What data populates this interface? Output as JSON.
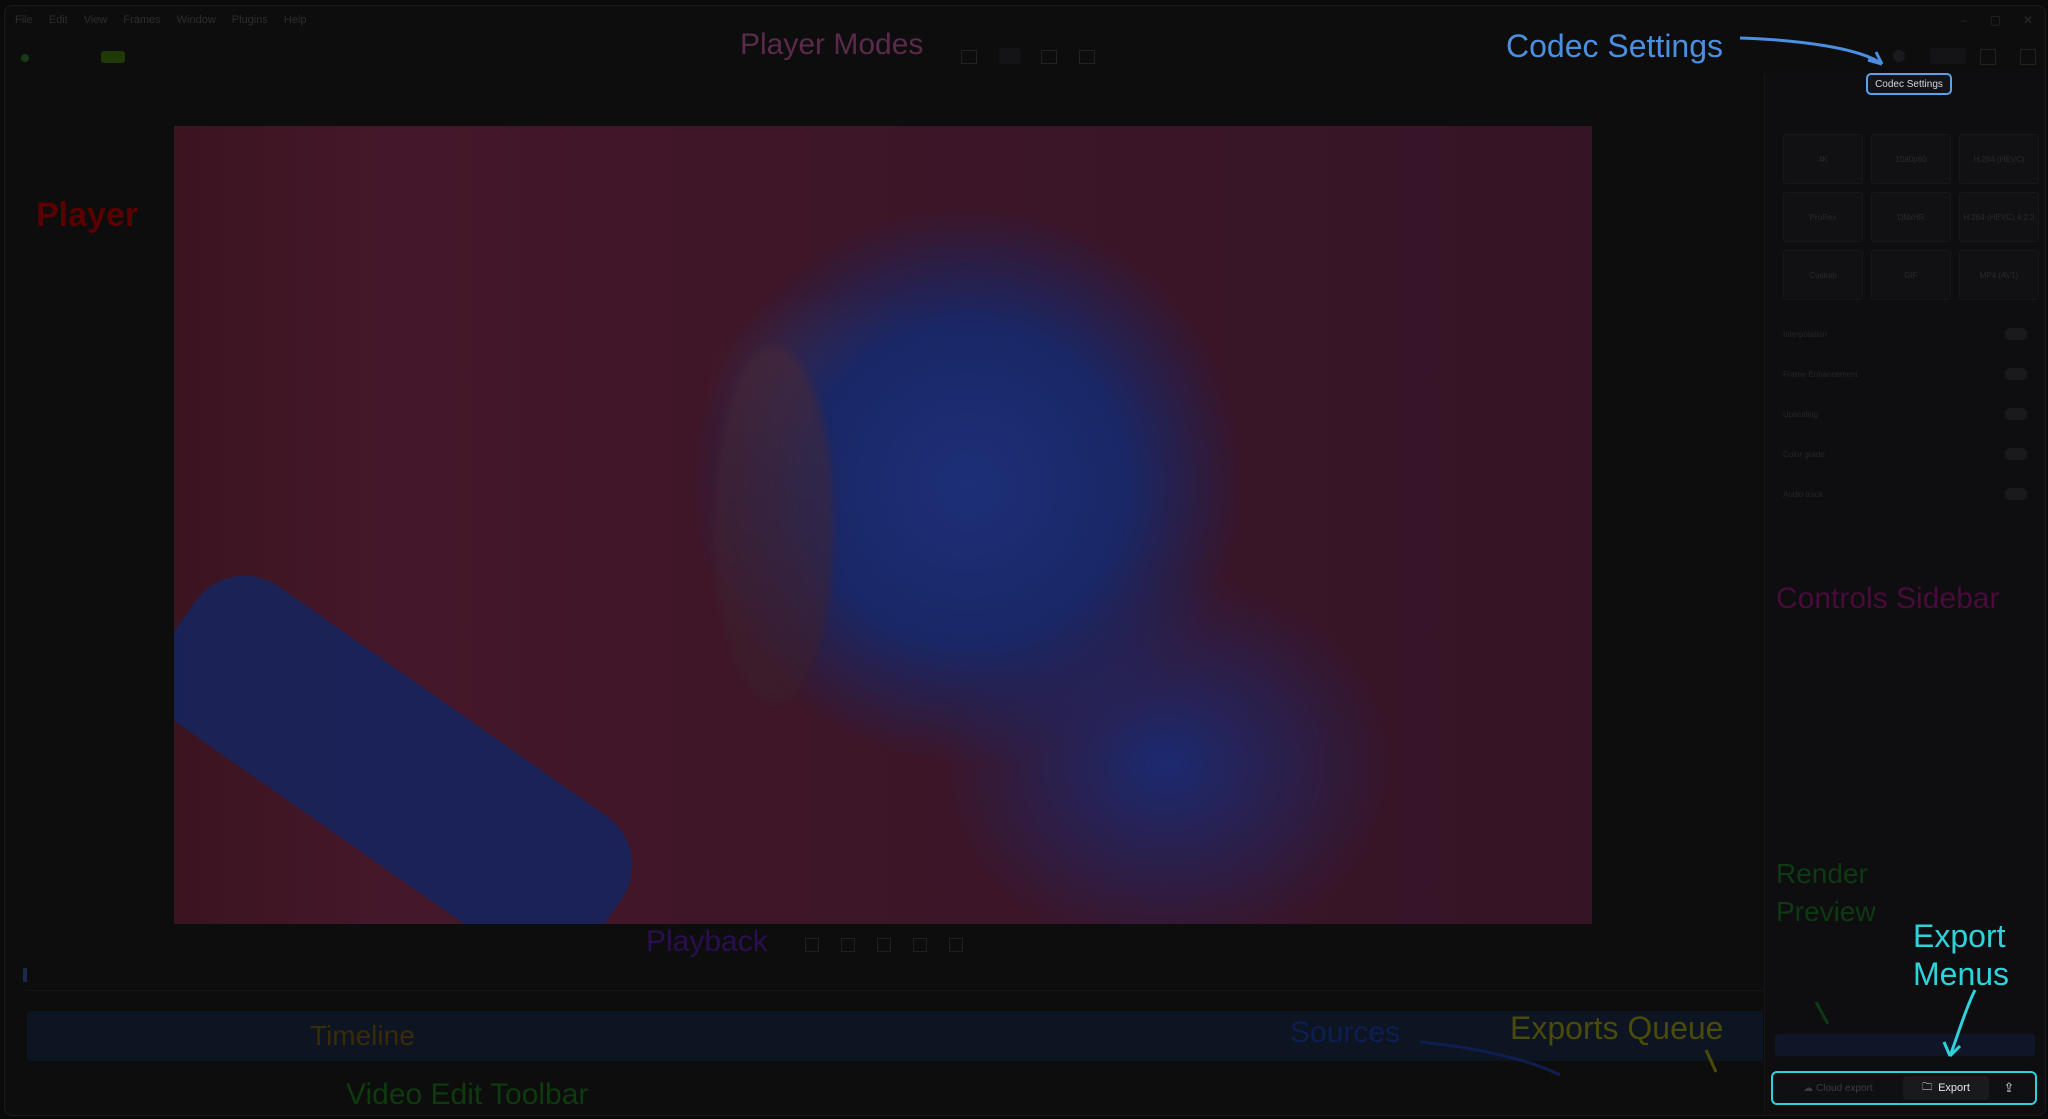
{
  "menu": [
    "File",
    "Edit",
    "View",
    "Frames",
    "Window",
    "Plugins",
    "Help"
  ],
  "overlay_labels": {
    "player_modes": "Player Modes",
    "codec_settings": "Codec Settings",
    "player": "Player",
    "controls_sidebar": "Controls Sidebar",
    "render_preview_1": "Render",
    "render_preview_2": "Preview",
    "export_menus_1": "Export",
    "export_menus_2": "Menus",
    "exports_queue": "Exports Queue",
    "sources": "Sources",
    "timeline": "Timeline",
    "playback": "Playback",
    "video_edit_toolbar": "Video Edit Toolbar"
  },
  "sidebar": {
    "codec_settings_button": "Codec Settings",
    "presets": [
      "4K",
      "1080p60",
      "H.264 (HEVC)",
      "ProRes",
      "DNxHR",
      "H.264 (HEVC) 4:2:2",
      "Custom",
      "GIF",
      "MP4 (AV1)",
      "",
      "",
      ""
    ],
    "toggles": [
      "Interpolation",
      "Frame Enhancement",
      "Upscaling",
      "Color grade",
      "Audio track"
    ]
  },
  "export": {
    "cloud_label": "Cloud export",
    "export_label": "Export"
  },
  "colors": {
    "codec_blue": "#4a8fe0",
    "export_cyan": "#2ed3da",
    "player_red": "#5a0000",
    "modes_pink": "#5a2a4a",
    "sidebar_magenta": "#4a0a3a",
    "render_green": "#0d3a12",
    "queue_olive": "#4a4a0a",
    "sources_navy": "#0e1e50",
    "timeline_orange": "#3a2a08",
    "playback_purple": "#2a0e50",
    "toolbar_green": "#0e3a0e"
  }
}
